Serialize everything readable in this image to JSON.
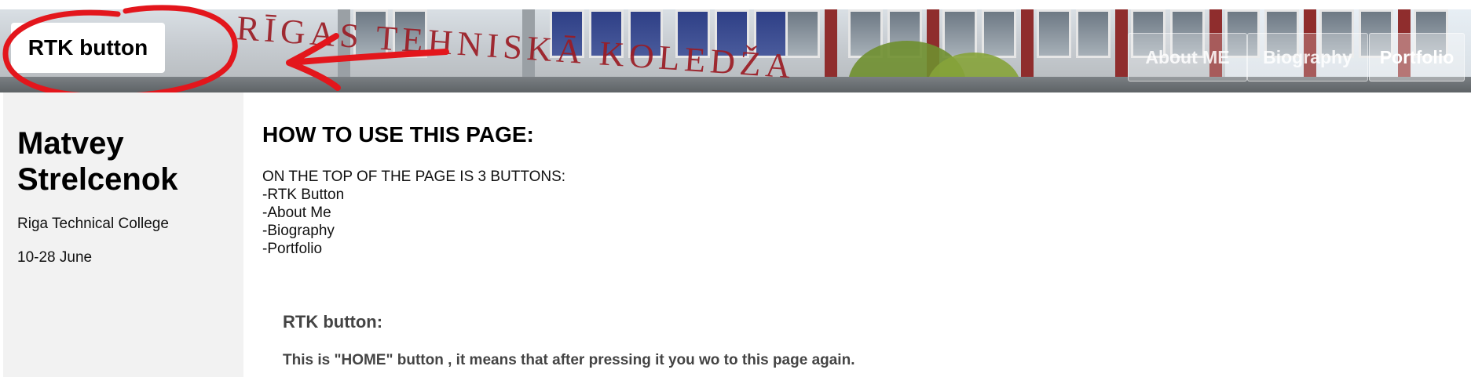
{
  "header": {
    "rtk_button_label": "RTK button",
    "nav": [
      {
        "label": "About ME"
      },
      {
        "label": "Biography"
      },
      {
        "label": "Portfolio"
      }
    ],
    "building_sign": "RĪGAS TEHNISKĀ KOLEDŽA"
  },
  "sidebar": {
    "name": "Matvey Strelcenok",
    "school": "Riga Technical College",
    "dates": "10-28 June"
  },
  "main": {
    "heading": "HOW TO USE THIS PAGE:",
    "intro": "ON THE TOP OF THE PAGE IS 3 BUTTONS:",
    "list": [
      "-RTK Button",
      "-About Me",
      "-Biography",
      "-Portfolio"
    ],
    "rtk_heading": "RTK button:",
    "rtk_description": "This is \"HOME\" button , it means that after pressing it you wo to this page again."
  },
  "colors": {
    "annotation_red": "#e3161c",
    "sidebar_bg": "#f2f2f2",
    "sign_red": "#9b1c24"
  },
  "icons": {
    "annotation_circle": "red-circle-annotation",
    "annotation_arrow": "red-arrow-annotation"
  }
}
